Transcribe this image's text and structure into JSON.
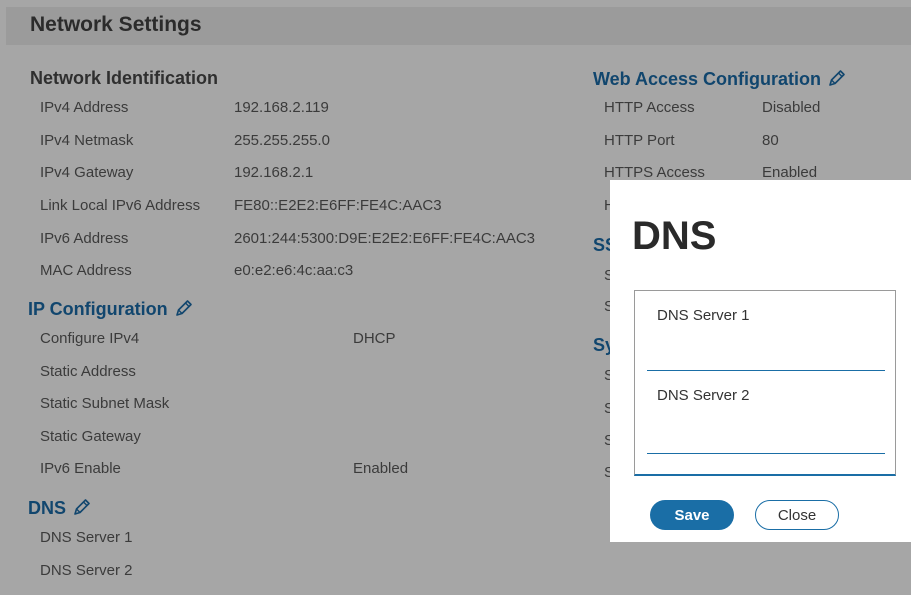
{
  "page": {
    "title": "Network Settings"
  },
  "network_identification": {
    "heading": "Network Identification",
    "rows": [
      {
        "label": "IPv4 Address",
        "value": "192.168.2.119"
      },
      {
        "label": "IPv4 Netmask",
        "value": "255.255.255.0"
      },
      {
        "label": "IPv4 Gateway",
        "value": "192.168.2.1"
      },
      {
        "label": "Link Local IPv6 Address",
        "value": "FE80::E2E2:E6FF:FE4C:AAC3"
      },
      {
        "label": "IPv6 Address",
        "value": "2601:244:5300:D9E:E2E2:E6FF:FE4C:AAC3"
      },
      {
        "label": "MAC Address",
        "value": "e0:e2:e6:4c:aa:c3"
      }
    ]
  },
  "ip_configuration": {
    "heading": "IP Configuration",
    "rows": [
      {
        "label": "Configure IPv4",
        "value": "DHCP"
      },
      {
        "label": "Static Address",
        "value": ""
      },
      {
        "label": "Static Subnet Mask",
        "value": ""
      },
      {
        "label": "Static Gateway",
        "value": ""
      },
      {
        "label": "IPv6 Enable",
        "value": "Enabled"
      }
    ]
  },
  "dns_section": {
    "heading": "DNS",
    "rows": [
      {
        "label": "DNS Server 1"
      },
      {
        "label": "DNS Server 2"
      }
    ]
  },
  "web_access": {
    "heading": "Web Access Configuration",
    "rows": [
      {
        "label": "HTTP Access",
        "value": "Disabled"
      },
      {
        "label": "HTTP Port",
        "value": "80"
      },
      {
        "label": "HTTPS Access",
        "value": "Enabled"
      },
      {
        "label": "H",
        "value": ""
      }
    ]
  },
  "ssh_section": {
    "heading": "SS",
    "rows": [
      "S",
      "S"
    ]
  },
  "system_section": {
    "heading": "Sy",
    "rows": [
      "S",
      "S",
      "S",
      "S"
    ]
  },
  "modal": {
    "title": "DNS",
    "field1_label": "DNS Server 1",
    "field1_value": "",
    "field2_label": "DNS Server 2",
    "field2_value": "",
    "save_label": "Save",
    "close_label": "Close"
  },
  "colors": {
    "accent": "#1a6ea6",
    "heading_blue": "#11466e",
    "overlay": "#a6a6a6",
    "modal_bg": "#ffffff"
  }
}
